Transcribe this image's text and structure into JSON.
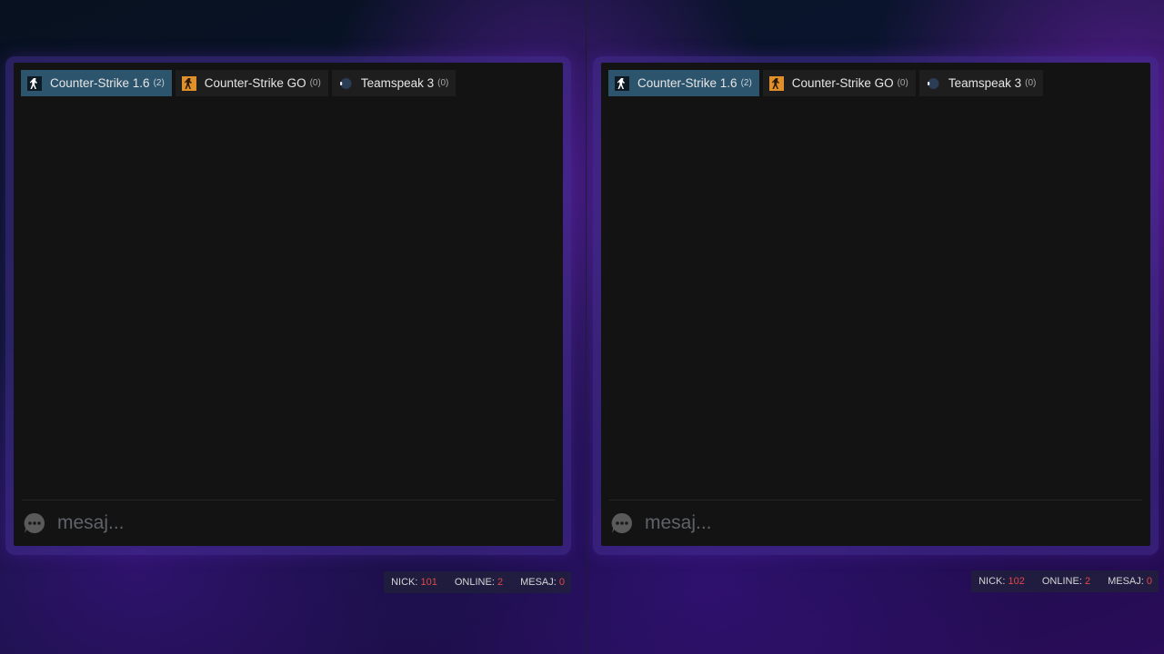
{
  "panes": [
    {
      "tabs": [
        {
          "label": "Counter-Strike 1.6",
          "count": "(2)",
          "icon": "cs16-icon",
          "active": true
        },
        {
          "label": "Counter-Strike GO",
          "count": "(0)",
          "icon": "csgo-icon",
          "active": false
        },
        {
          "label": "Teamspeak 3",
          "count": "(0)",
          "icon": "teamspeak-icon",
          "active": false
        }
      ],
      "input": {
        "placeholder": "mesaj...",
        "value": ""
      },
      "stats": {
        "nick_label": "NICK:",
        "nick_value": "101",
        "online_label": "ONLINE:",
        "online_value": "2",
        "mesaj_label": "MESAJ:",
        "mesaj_value": "0"
      }
    },
    {
      "tabs": [
        {
          "label": "Counter-Strike 1.6",
          "count": "(2)",
          "icon": "cs16-icon",
          "active": true
        },
        {
          "label": "Counter-Strike GO",
          "count": "(0)",
          "icon": "csgo-icon",
          "active": false
        },
        {
          "label": "Teamspeak 3",
          "count": "(0)",
          "icon": "teamspeak-icon",
          "active": false
        }
      ],
      "input": {
        "placeholder": "mesaj...",
        "value": ""
      },
      "stats": {
        "nick_label": "NICK:",
        "nick_value": "102",
        "online_label": "ONLINE:",
        "online_value": "2",
        "mesaj_label": "MESAJ:",
        "mesaj_value": "0"
      }
    }
  ],
  "colors": {
    "active_tab": "#2d546d",
    "tab_bg": "#1e1e1e",
    "chat_bg": "#131313",
    "stat_value": "#e04848",
    "frame": "#46308f"
  }
}
